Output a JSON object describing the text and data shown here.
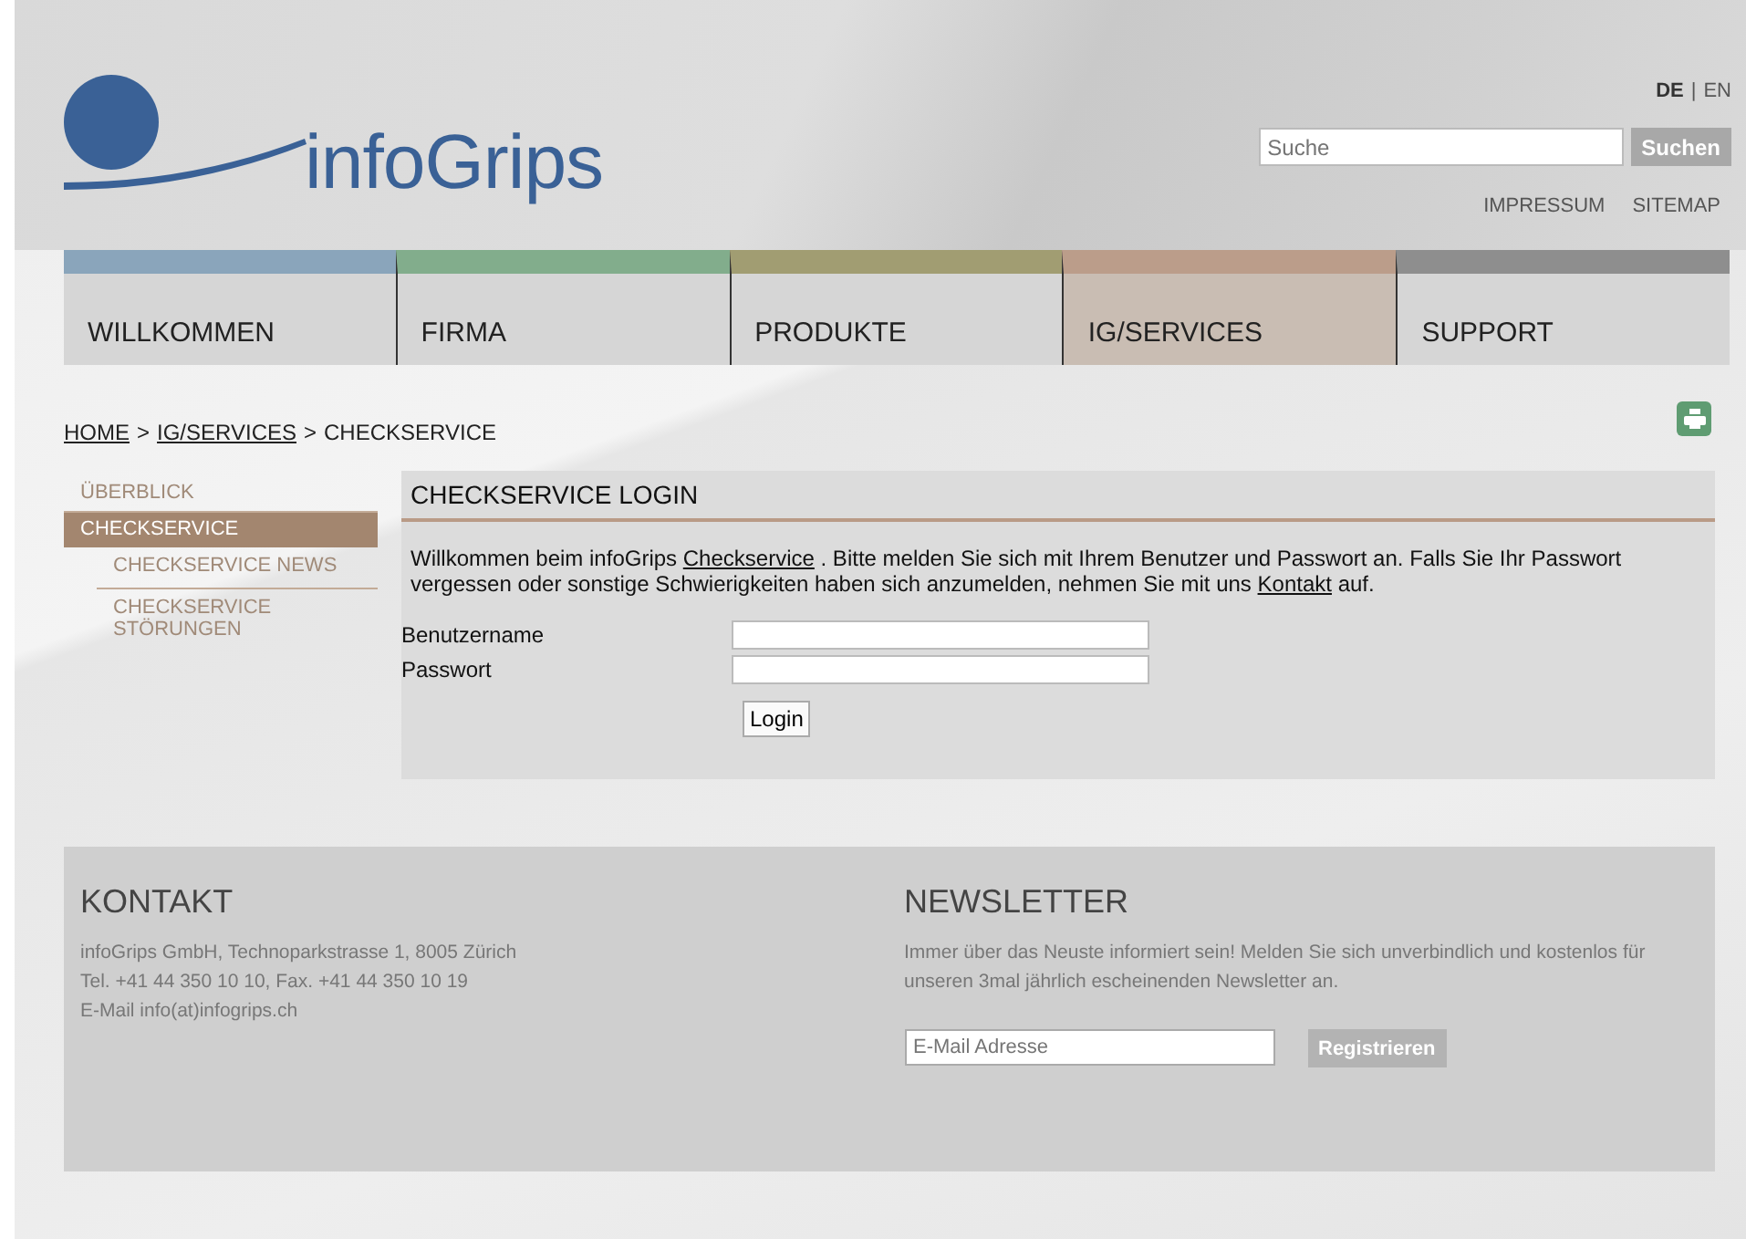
{
  "logo": {
    "text": "infoGrips"
  },
  "languages": [
    {
      "kind": "link",
      "label": "DE",
      "selected": true
    },
    {
      "kind": "sep",
      "label": "|"
    },
    {
      "kind": "link",
      "label": "EN",
      "selected": false
    }
  ],
  "search": {
    "placeholder": "Suche",
    "button": "Suchen"
  },
  "top_links": [
    "IMPRESSUM",
    "SITEMAP"
  ],
  "nav": [
    {
      "label": "WILLKOMMEN",
      "color": "#8aa5bb",
      "selected": false
    },
    {
      "label": "FIRMA",
      "color": "#82ad8c",
      "selected": false
    },
    {
      "label": "PRODUKTE",
      "color": "#a19d72",
      "selected": false
    },
    {
      "label": "IG/SERVICES",
      "color": "#bb9d8a",
      "selected": true
    },
    {
      "label": "SUPPORT",
      "color": "#8e8e8e",
      "selected": false
    }
  ],
  "breadcrumb": [
    {
      "kind": "link",
      "text": "HOME"
    },
    {
      "kind": "sep",
      "text": ">"
    },
    {
      "kind": "link",
      "text": "IG/SERVICES"
    },
    {
      "kind": "sep",
      "text": ">"
    },
    {
      "kind": "current",
      "text": "CHECKSERVICE"
    }
  ],
  "sidebar": {
    "items": [
      {
        "label": "ÜBERBLICK",
        "selected": false
      },
      {
        "label": "CHECKSERVICE",
        "selected": true,
        "children": [
          {
            "label": "CHECKSERVICE NEWS",
            "selected": false
          },
          {
            "label": "CHECKSERVICE STÖRUNGEN",
            "selected": false
          }
        ]
      }
    ]
  },
  "login": {
    "title": "CHECKSERVICE LOGIN",
    "intro": [
      {
        "kind": "text",
        "text": "Willkommen beim infoGrips"
      },
      {
        "kind": "link",
        "text": "Checkservice"
      },
      {
        "kind": "text",
        "text": ". Bitte melden Sie sich mit Ihrem Benutzer und Passwort an. Falls Sie Ihr Passwort vergessen oder sonstige Schwierigkeiten haben sich anzumelden, nehmen Sie mit uns"
      },
      {
        "kind": "link",
        "text": "Kontakt"
      },
      {
        "kind": "text",
        "text": "auf."
      }
    ],
    "fields": [
      {
        "label": "Benutzername"
      },
      {
        "label": "Passwort"
      }
    ],
    "button": "Login"
  },
  "footer": {
    "contact": {
      "title": "KONTAKT",
      "lines": [
        "infoGrips GmbH,  Technoparkstrasse 1,  8005 Zürich",
        "Tel. +41 44 350 10 10,  Fax. +41 44 350 10 19",
        "E-Mail info(at)infogrips.ch"
      ]
    },
    "newsletter": {
      "title": "NEWSLETTER",
      "text": "Immer über das Neuste informiert sein! Melden Sie sich unverbindlich und kostenlos für unseren 3mal jährlich escheinenden Newsletter an.",
      "placeholder": "E-Mail Adresse",
      "button": "Registrieren"
    }
  }
}
